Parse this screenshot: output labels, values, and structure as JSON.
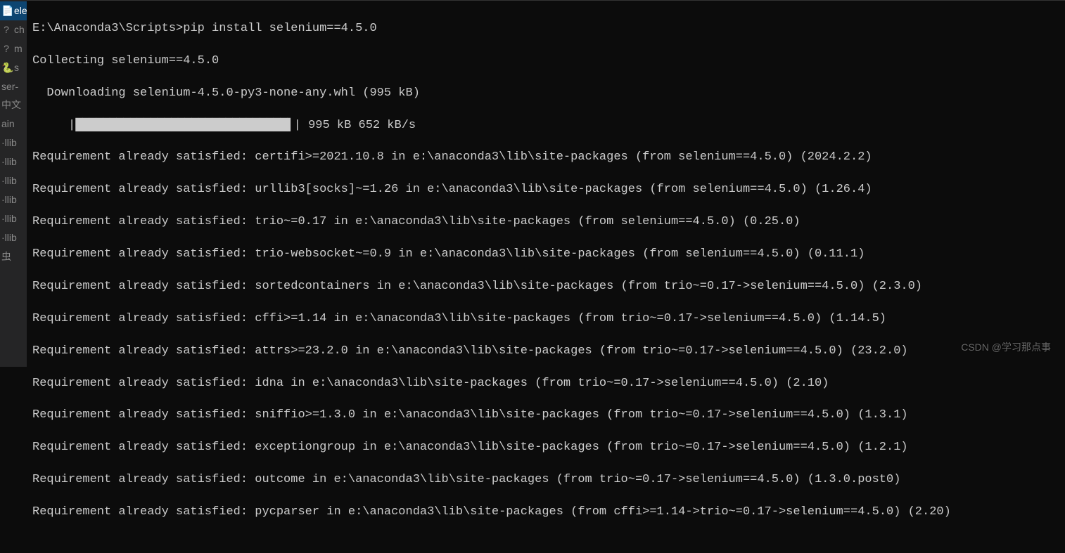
{
  "sidebar": {
    "items": [
      {
        "icon": "📄",
        "label": "elen"
      },
      {
        "icon": "?",
        "label": "ch"
      },
      {
        "icon": "?",
        "label": "m"
      },
      {
        "icon": "🐍",
        "label": "s"
      },
      {
        "icon": "",
        "label": "ser-"
      },
      {
        "icon": "",
        "label": "中文"
      },
      {
        "icon": "",
        "label": "ain"
      },
      {
        "icon": "",
        "label": "·llib"
      },
      {
        "icon": "",
        "label": "·llib"
      },
      {
        "icon": "",
        "label": "·llib"
      },
      {
        "icon": "",
        "label": "·llib"
      },
      {
        "icon": "",
        "label": "·llib"
      },
      {
        "icon": "",
        "label": "·llib"
      },
      {
        "icon": "",
        "label": "虫"
      }
    ]
  },
  "terminal": {
    "prompt": "E:\\Anaconda3\\Scripts>",
    "command": "pip install selenium==4.5.0",
    "collecting": "Collecting selenium==4.5.0",
    "downloading": "  Downloading selenium-4.5.0-py3-none-any.whl (995 kB)",
    "progress": {
      "prefix": "     |",
      "bar": "███████████████████████████████▌",
      "suffix": "| 995 kB 652 kB/s"
    },
    "lines": [
      "Requirement already satisfied: certifi>=2021.10.8 in e:\\anaconda3\\lib\\site-packages (from selenium==4.5.0) (2024.2.2)",
      "Requirement already satisfied: urllib3[socks]~=1.26 in e:\\anaconda3\\lib\\site-packages (from selenium==4.5.0) (1.26.4)",
      "Requirement already satisfied: trio~=0.17 in e:\\anaconda3\\lib\\site-packages (from selenium==4.5.0) (0.25.0)",
      "Requirement already satisfied: trio-websocket~=0.9 in e:\\anaconda3\\lib\\site-packages (from selenium==4.5.0) (0.11.1)",
      "Requirement already satisfied: sortedcontainers in e:\\anaconda3\\lib\\site-packages (from trio~=0.17->selenium==4.5.0) (2.3.0)",
      "Requirement already satisfied: cffi>=1.14 in e:\\anaconda3\\lib\\site-packages (from trio~=0.17->selenium==4.5.0) (1.14.5)",
      "Requirement already satisfied: attrs>=23.2.0 in e:\\anaconda3\\lib\\site-packages (from trio~=0.17->selenium==4.5.0) (23.2.0)",
      "Requirement already satisfied: idna in e:\\anaconda3\\lib\\site-packages (from trio~=0.17->selenium==4.5.0) (2.10)",
      "Requirement already satisfied: sniffio>=1.3.0 in e:\\anaconda3\\lib\\site-packages (from trio~=0.17->selenium==4.5.0) (1.3.1)",
      "Requirement already satisfied: exceptiongroup in e:\\anaconda3\\lib\\site-packages (from trio~=0.17->selenium==4.5.0) (1.2.1)",
      "Requirement already satisfied: outcome in e:\\anaconda3\\lib\\site-packages (from trio~=0.17->selenium==4.5.0) (1.3.0.post0)",
      "Requirement already satisfied: pycparser in e:\\anaconda3\\lib\\site-packages (from cffi>=1.14->trio~=0.17->selenium==4.5.0) (2.20)"
    ]
  },
  "watermark": "CSDN @学习那点事"
}
